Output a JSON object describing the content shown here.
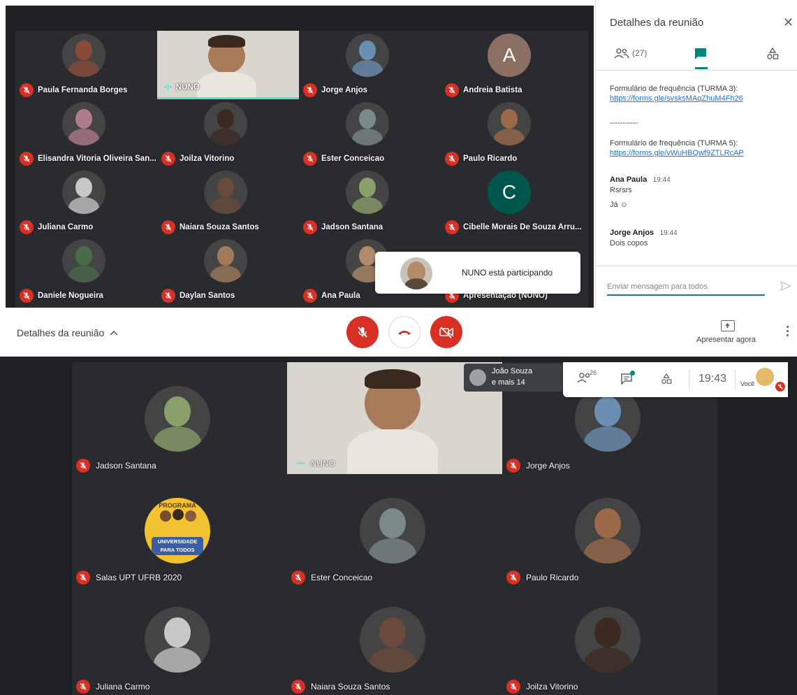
{
  "meeting_details_label": "Detalhes da reunião",
  "panel": {
    "title": "Detalhes da reunião",
    "people_count": "(27)",
    "messages": [
      {
        "type": "text",
        "text": "Formulário de frequência (TURMA 3):"
      },
      {
        "type": "link",
        "text": "https://forms.gle/svsksMAqZhuM4Fh26"
      },
      {
        "type": "text",
        "text": "-----------"
      },
      {
        "type": "text",
        "text": "Formulário de frequência (TURMA 5):"
      },
      {
        "type": "link",
        "text": "https://forms.gle/vWuHBQwf9ZTLRcAP"
      }
    ],
    "chats": [
      {
        "author": "Ana Paula",
        "time": "19:44",
        "lines": [
          "Rsrsrs",
          "Já ☺"
        ]
      },
      {
        "author": "Jorge Anjos",
        "time": "19:44",
        "lines": [
          "Dois copos"
        ]
      }
    ],
    "input_placeholder": "Enviar mensagem para todos"
  },
  "top_grid": {
    "tiles": [
      {
        "name": "Paula Fernanda Borges",
        "avatar": "photo",
        "color": "#8a4a3a"
      },
      {
        "name": "NUNO",
        "avatar": "video"
      },
      {
        "name": "Jorge Anjos",
        "avatar": "photo",
        "color": "#6b8fb3"
      },
      {
        "name": "Andreia Batista",
        "avatar": "letter",
        "letter": "A",
        "color": "#8d6e63"
      },
      {
        "name": "Elisandra Vitoria Oliveira San...",
        "avatar": "photo",
        "color": "#b07a8c"
      },
      {
        "name": "Joilza Vitorino",
        "avatar": "photo",
        "color": "#3b2a22"
      },
      {
        "name": "Ester Conceicao",
        "avatar": "photo",
        "color": "#7a8a8a"
      },
      {
        "name": "Paulo Ricardo",
        "avatar": "photo",
        "color": "#9a6a4a"
      },
      {
        "name": "Juliana Carmo",
        "avatar": "photo",
        "color": "#c8c8c8"
      },
      {
        "name": "Naiara Souza Santos",
        "avatar": "photo",
        "color": "#6a4a3a"
      },
      {
        "name": "Jadson Santana",
        "avatar": "photo",
        "color": "#8aa06a"
      },
      {
        "name": "Cibelle Morais De Souza Arru...",
        "avatar": "letter",
        "letter": "C",
        "color": "#00574b"
      },
      {
        "name": "Daniele Nogueira",
        "avatar": "photo",
        "color": "#4a6a4a"
      },
      {
        "name": "Daylan Santos",
        "avatar": "photo",
        "color": "#a07a5a"
      },
      {
        "name": "Ana Paula",
        "avatar": "photo",
        "color": "#b08a6a"
      },
      {
        "name": "Apresentação (NUNO)",
        "avatar": "none"
      }
    ]
  },
  "toast": {
    "text": "NUNO está participando"
  },
  "controls": {
    "meeting_details": "Detalhes da reunião",
    "present_now": "Apresentar agora"
  },
  "bottom_grid": {
    "tiles": [
      {
        "name": "Jadson Santana",
        "avatar": "photo",
        "color": "#8aa06a"
      },
      {
        "name": "NUNO",
        "avatar": "video"
      },
      {
        "name": "Jorge Anjos",
        "avatar": "photo",
        "color": "#6b8fb3"
      },
      {
        "name": "Salas UPT UFRB 2020",
        "avatar": "logo",
        "color": "#f2c230",
        "logo_top": "PROGRAMA",
        "logo_bottom": "UNIVERSIDADE PARA TODOS"
      },
      {
        "name": "Ester Conceicao",
        "avatar": "photo",
        "color": "#7a8a8a"
      },
      {
        "name": "Paulo Ricardo",
        "avatar": "photo",
        "color": "#9a6a4a"
      },
      {
        "name": "Juliana Carmo",
        "avatar": "photo",
        "color": "#c8c8c8"
      },
      {
        "name": "Naiara Souza Santos",
        "avatar": "photo",
        "color": "#6a4a3a"
      },
      {
        "name": "Joilza Vitorino",
        "avatar": "photo",
        "color": "#3b2a22"
      }
    ]
  },
  "tray": {
    "others_name": "João Souza",
    "others_more": "e mais 14",
    "people_count": "26",
    "time": "19:43",
    "you_label": "Você"
  },
  "colors": {
    "red": "#d93025",
    "accent": "#00897b",
    "speaking": "#5ce1c6"
  }
}
